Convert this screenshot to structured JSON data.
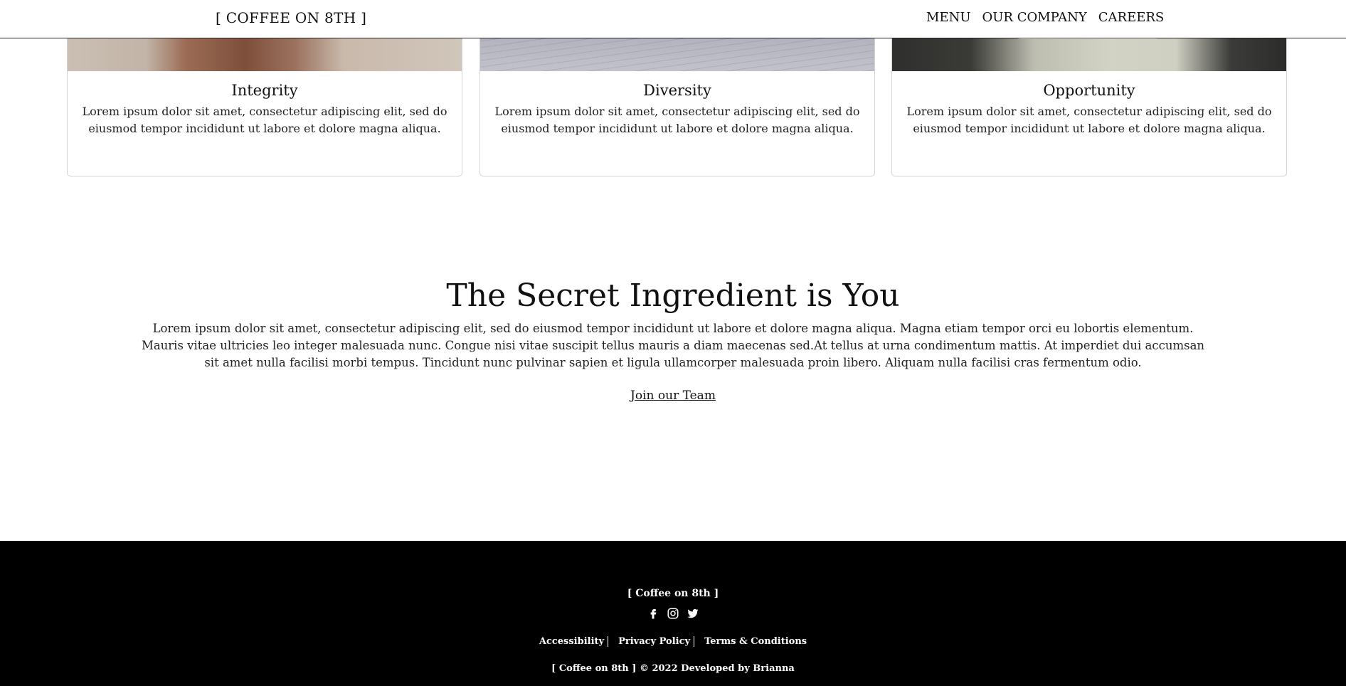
{
  "header": {
    "brand": "[ COFFEE ON 8TH ]",
    "nav": [
      "MENU",
      "OUR COMPANY",
      "CAREERS"
    ]
  },
  "cards": [
    {
      "title": "Integrity",
      "text": "Lorem ipsum dolor sit amet, consectetur adipiscing elit, sed do eiusmod tempor incididunt ut labore et dolore magna aliqua."
    },
    {
      "title": "Diversity",
      "text": "Lorem ipsum dolor sit amet, consectetur adipiscing elit, sed do eiusmod tempor incididunt ut labore et dolore magna aliqua."
    },
    {
      "title": "Opportunity",
      "text": "Lorem ipsum dolor sit amet, consectetur adipiscing elit, sed do eiusmod tempor incididunt ut labore et dolore magna aliqua."
    }
  ],
  "main": {
    "headline": "The Secret Ingredient is You",
    "body": "Lorem ipsum dolor sit amet, consectetur adipiscing elit, sed do eiusmod tempor incididunt ut labore et dolore magna aliqua. Magna etiam tempor orci eu lobortis elementum. Mauris vitae ultricies leo integer malesuada nunc. Congue nisi vitae suscipit tellus mauris a diam maecenas sed.At tellus at urna condimentum mattis. At imperdiet dui accumsan sit amet nulla facilisi morbi tempus. Tincidunt nunc pulvinar sapien et ligula ullamcorper malesuada proin libero. Aliquam nulla facilisi cras fermentum odio.",
    "cta": "Join our Team"
  },
  "footer": {
    "brand": "[ Coffee on 8th ]",
    "socials": [
      "facebook-icon",
      "instagram-icon",
      "twitter-icon"
    ],
    "links": [
      "Accessibility",
      "Privacy Policy",
      "Terms & Conditions"
    ],
    "copyright": "[ Coffee on 8th ] © 2022 Developed by Brianna"
  },
  "colors": {
    "footer_bg": "#000000",
    "text": "#222222",
    "header_border": "#222222"
  }
}
